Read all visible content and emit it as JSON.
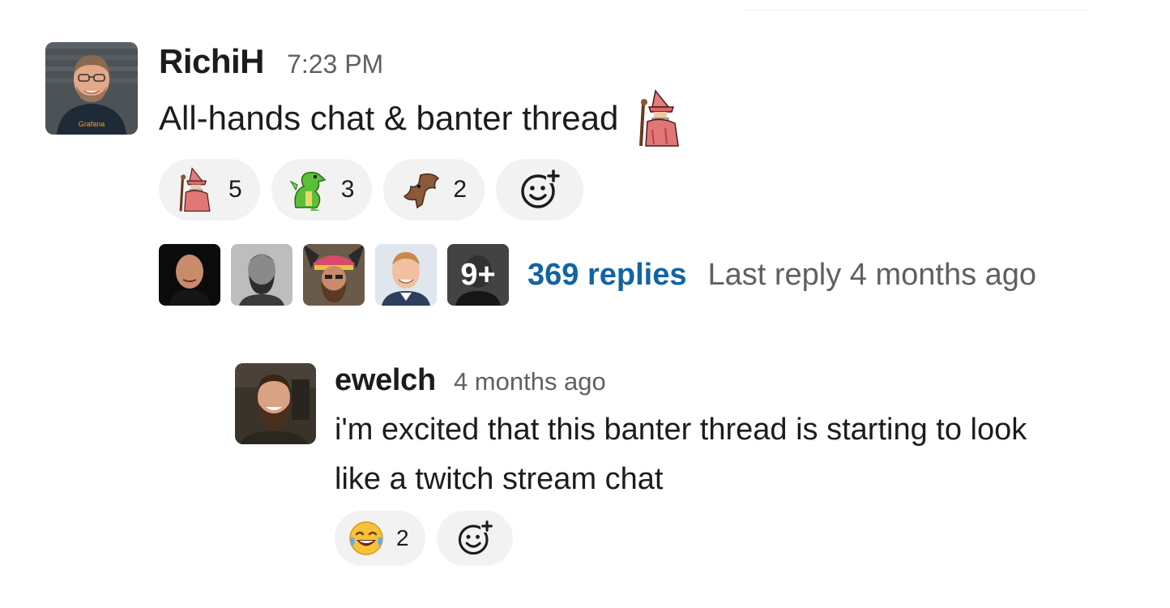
{
  "message": {
    "author": "RichiH",
    "time": "7:23 PM",
    "text": "All-hands chat & banter thread",
    "inline_emoji": "wizard",
    "avatar_icon": "user-avatar-richih",
    "reactions": [
      {
        "emoji": "wizard",
        "count": "5"
      },
      {
        "emoji": "dragon",
        "count": "3"
      },
      {
        "emoji": "bat",
        "count": "2"
      }
    ],
    "add_reaction_icon": "add-reaction-icon"
  },
  "thread": {
    "participants": [
      "participant-1",
      "participant-2",
      "participant-3",
      "participant-4"
    ],
    "more_label": "9+",
    "replies_label": "369 replies",
    "last_reply": "Last reply 4 months ago"
  },
  "reply": {
    "author": "ewelch",
    "time": "4 months ago",
    "text": "i'm excited that this banter thread is starting to look like a twitch stream chat",
    "reactions": [
      {
        "emoji": "joy",
        "count": "2"
      }
    ],
    "add_reaction_icon": "add-reaction-icon"
  },
  "colors": {
    "link": "#1264a3",
    "muted": "#616061",
    "text": "#1d1c1d",
    "reaction_bg": "#f2f2f2"
  }
}
